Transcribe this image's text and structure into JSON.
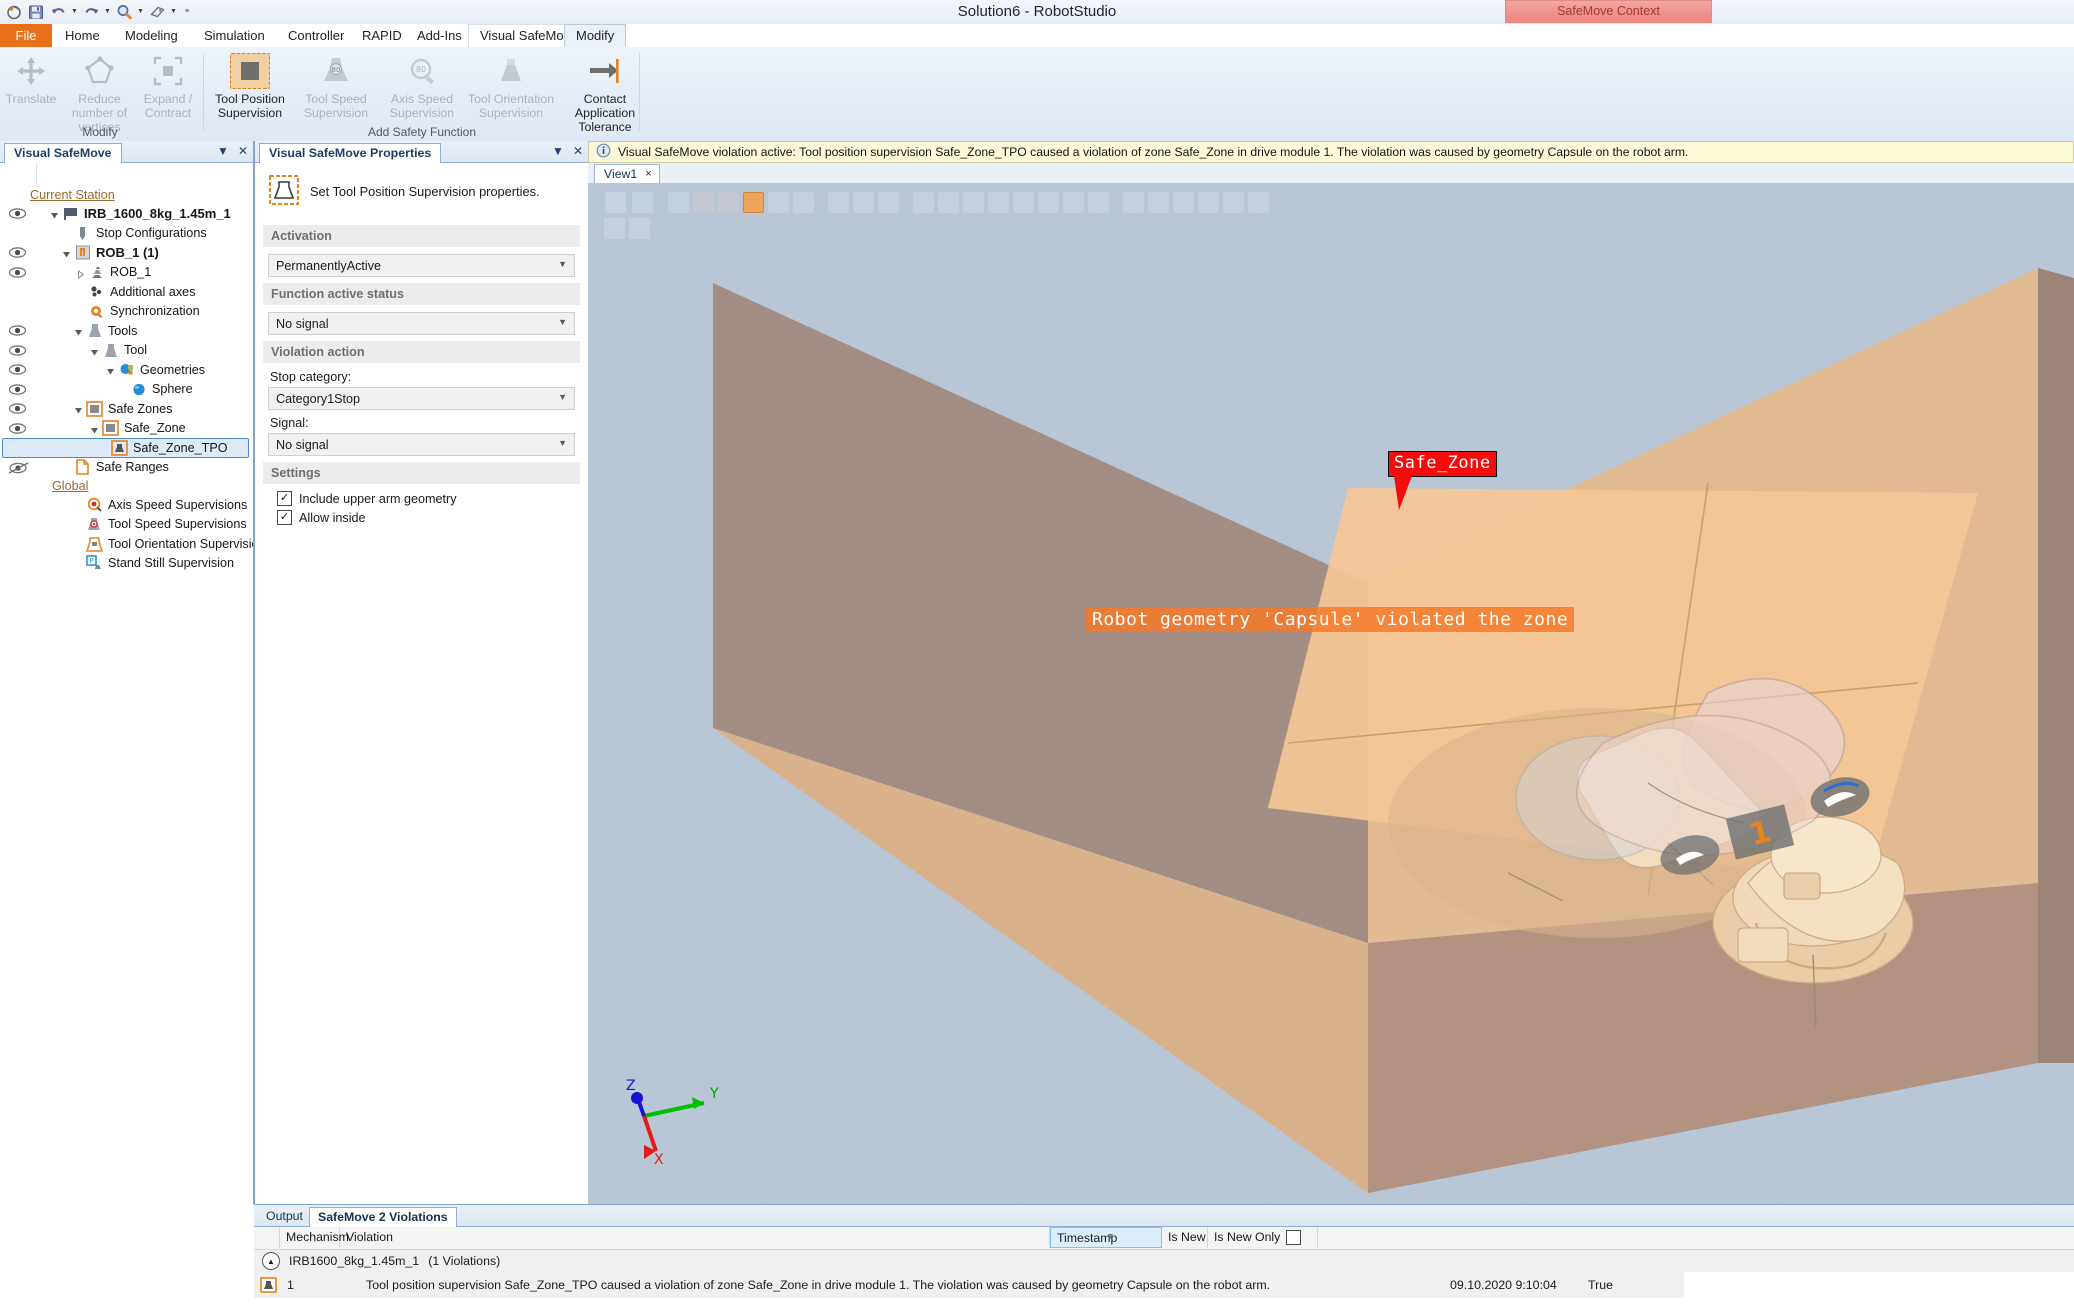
{
  "window": {
    "title": "Solution6 - RobotStudio",
    "context_tab": "SafeMove Context"
  },
  "quick_access": {
    "icons": [
      "restore-icon",
      "save-icon",
      "undo-icon",
      "undo-dropdown-icon",
      "redo-icon",
      "redo-dropdown-icon",
      "search-icon",
      "search-dropdown-icon",
      "tag-icon",
      "tag-dropdown-icon",
      "customize-qat-icon"
    ]
  },
  "ribbon": {
    "tabs": [
      {
        "label": "File",
        "state": "file"
      },
      {
        "label": "Home",
        "state": "normal"
      },
      {
        "label": "Modeling",
        "state": "normal"
      },
      {
        "label": "Simulation",
        "state": "normal"
      },
      {
        "label": "Controller",
        "state": "normal"
      },
      {
        "label": "RAPID",
        "state": "normal"
      },
      {
        "label": "Add-Ins",
        "state": "normal"
      },
      {
        "label": "Visual SafeMove",
        "state": "context"
      },
      {
        "label": "Modify",
        "state": "active"
      }
    ],
    "groups": [
      {
        "label": "Modify",
        "buttons": [
          {
            "label": "Translate",
            "icon": "translate-icon",
            "enabled": false,
            "selected": false
          },
          {
            "label": "Reduce number of vertices",
            "icon": "reduce-vertices-icon",
            "enabled": false,
            "selected": false
          },
          {
            "label": "Expand / Contract",
            "icon": "expand-contract-icon",
            "enabled": false,
            "selected": false
          }
        ]
      },
      {
        "label": "Add Safety Function",
        "buttons": [
          {
            "label": "Tool Position Supervision",
            "icon": "tool-position-supervision-icon",
            "enabled": true,
            "selected": true
          },
          {
            "label": "Tool Speed Supervision",
            "icon": "tool-speed-supervision-icon",
            "enabled": false,
            "selected": false
          },
          {
            "label": "Axis Speed Supervision",
            "icon": "axis-speed-supervision-icon",
            "enabled": false,
            "selected": false
          },
          {
            "label": "Tool Orientation Supervision",
            "icon": "tool-orientation-supervision-icon",
            "enabled": false,
            "selected": false
          },
          {
            "label": "Contact Application Tolerance",
            "icon": "contact-application-tolerance-icon",
            "enabled": true,
            "selected": false
          }
        ]
      }
    ]
  },
  "browser": {
    "tab_label": "Visual SafeMove",
    "tools": [
      "panel-menu-icon",
      "panel-close-icon"
    ],
    "group_current": "Current Station",
    "group_global": "Global",
    "items": [
      {
        "label": "IRB_1600_8kg_1.45m_1",
        "indent": 1,
        "eye": true,
        "twist": "down",
        "icon": "station-icon",
        "bold": true,
        "selected": false
      },
      {
        "label": "Stop Configurations",
        "indent": 2,
        "eye": false,
        "twist": "none",
        "icon": "stop-config-icon",
        "bold": false,
        "selected": false
      },
      {
        "label": "ROB_1 (1)",
        "indent": 1,
        "eye": true,
        "twist": "down",
        "icon": "drive-module-icon",
        "bold": true,
        "selected": false
      },
      {
        "label": "ROB_1",
        "indent": 2,
        "eye": true,
        "twist": "right",
        "icon": "robot-icon",
        "bold": false,
        "selected": false
      },
      {
        "label": "Additional axes",
        "indent": 3,
        "eye": false,
        "twist": "none",
        "icon": "additional-axes-icon",
        "bold": false,
        "selected": false
      },
      {
        "label": "Synchronization",
        "indent": 3,
        "eye": false,
        "twist": "none",
        "icon": "synchronization-icon",
        "bold": false,
        "selected": false
      },
      {
        "label": "Tools",
        "indent": 2,
        "eye": true,
        "twist": "down",
        "icon": "tools-icon",
        "bold": false,
        "selected": false
      },
      {
        "label": "Tool",
        "indent": 3,
        "eye": true,
        "twist": "down",
        "icon": "tool-icon",
        "bold": false,
        "selected": false
      },
      {
        "label": "Geometries",
        "indent": 4,
        "eye": true,
        "twist": "down",
        "icon": "geometries-icon",
        "bold": false,
        "selected": false
      },
      {
        "label": "Sphere",
        "indent": 5,
        "eye": true,
        "twist": "none",
        "icon": "sphere-icon",
        "bold": false,
        "selected": false
      },
      {
        "label": "Safe Zones",
        "indent": 2,
        "eye": true,
        "twist": "down",
        "icon": "safe-zones-icon",
        "bold": false,
        "selected": false
      },
      {
        "label": "Safe_Zone",
        "indent": 3,
        "eye": true,
        "twist": "down",
        "icon": "safe-zone-icon",
        "bold": false,
        "selected": false
      },
      {
        "label": "Safe_Zone_TPO",
        "indent": 4,
        "eye": false,
        "twist": "none",
        "icon": "tool-position-supervision-icon",
        "bold": false,
        "selected": true
      },
      {
        "label": "Safe Ranges",
        "indent": 2,
        "eye": true,
        "twist": "none",
        "icon": "safe-ranges-icon",
        "bold": false,
        "selected": false
      }
    ],
    "global_items": [
      {
        "label": "Axis Speed Supervisions",
        "icon": "axis-speed-supervision-icon"
      },
      {
        "label": "Tool Speed Supervisions",
        "icon": "tool-speed-supervision-icon"
      },
      {
        "label": "Tool Orientation Supervisions",
        "icon": "tool-orientation-supervision-icon"
      },
      {
        "label": "Stand Still Supervision",
        "icon": "stand-still-supervision-icon"
      }
    ]
  },
  "properties": {
    "tab_label": "Visual SafeMove Properties",
    "tools": [
      "panel-menu-icon",
      "panel-close-icon"
    ],
    "intro_text": "Set Tool Position Supervision properties.",
    "intro_icon": "tool-position-supervision-icon",
    "sections": {
      "activation": {
        "header": "Activation",
        "value": "PermanentlyActive",
        "options": [
          "PermanentlyActive"
        ]
      },
      "function_active_status": {
        "header": "Function active status",
        "value": "No signal",
        "options": [
          "No signal"
        ]
      },
      "violation_action": {
        "header": "Violation action",
        "stop_category_label": "Stop category:",
        "stop_category_value": "Category1Stop",
        "signal_label": "Signal:",
        "signal_value": "No signal"
      },
      "settings": {
        "header": "Settings",
        "checkboxes": [
          {
            "label": "Include upper arm geometry",
            "checked": true
          },
          {
            "label": "Allow inside",
            "checked": true
          }
        ]
      }
    }
  },
  "view": {
    "info_icon": "info-icon",
    "info_message": "Visual SafeMove violation active:  Tool position supervision Safe_Zone_TPO caused a violation of zone Safe_Zone in drive module 1. The violation was caused by geometry Capsule on the robot arm.",
    "tab_label": "View1",
    "tab_close": "×",
    "zone_label": "Safe_Zone",
    "violation_overlay": "Robot geometry 'Capsule' violated the zone",
    "axes": {
      "x": "X",
      "y": "Y",
      "z": "Z"
    },
    "axis_colors": {
      "x": "#e21a1a",
      "y": "#00c000",
      "z": "#1414d2"
    },
    "colors": {
      "background": "#b8c6d5",
      "zone_fill": "#f5c796",
      "zone_side": "#a79086",
      "label_red": "#f50d0d",
      "banner_orange": "#f47a2a"
    }
  },
  "bottom_panel": {
    "tabs": [
      {
        "label": "Output",
        "active": false
      },
      {
        "label": "SafeMove 2 Violations",
        "active": true
      }
    ],
    "columns": [
      "",
      "Mechanism",
      "Violation",
      "Timestamp",
      "Is New",
      "Is New Only"
    ],
    "sorted_column": "Timestamp",
    "is_new_only_checked": false,
    "group": {
      "label": "IRB1600_8kg_1.45m_1",
      "count_text": "(1 Violations)"
    },
    "rows": [
      {
        "icon": "tool-position-supervision-icon",
        "number": "1",
        "violation": "Tool position supervision Safe_Zone_TPO caused a violation of zone Safe_Zone in drive module 1. The violation was caused by geometry Capsule on the robot arm.",
        "timestamp": "09.10.2020 9:10:04",
        "is_new": "True"
      }
    ]
  }
}
